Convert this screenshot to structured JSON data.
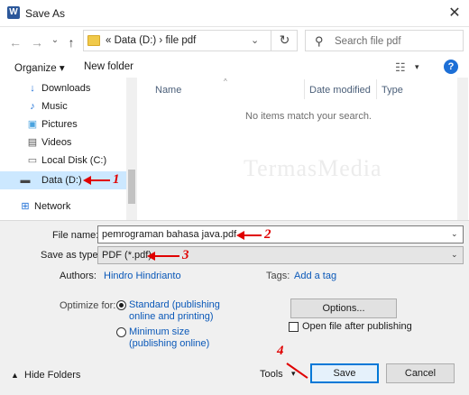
{
  "window": {
    "title": "Save As",
    "app_icon": "W",
    "close": "✕"
  },
  "nav": {
    "back": "←",
    "forward": "→",
    "down": "⌄",
    "up": "↑"
  },
  "address": {
    "path": "«  Data (D:)  ›  file pdf",
    "refresh": "↻",
    "dropdown": "⌄"
  },
  "search": {
    "placeholder": "Search file pdf",
    "icon": "search-icon"
  },
  "toolbar": {
    "organize": "Organize ▾",
    "new_folder": "New folder",
    "view": "☷",
    "view_drop": "▾",
    "help": "?"
  },
  "sidebar": {
    "items": [
      {
        "label": "Downloads",
        "icon": "↓",
        "color": "#1d6fd6"
      },
      {
        "label": "Music",
        "icon": "♪",
        "color": "#1d6fd6"
      },
      {
        "label": "Pictures",
        "icon": "▣",
        "color": "#4aa3df"
      },
      {
        "label": "Videos",
        "icon": "▤",
        "color": "#555555"
      },
      {
        "label": "Local Disk (C:)",
        "icon": "▭",
        "color": "#666666"
      },
      {
        "label": "Data (D:)",
        "icon": "▬",
        "color": "#444444"
      },
      {
        "label": "Network",
        "icon": "⊞",
        "color": "#1d6fd6"
      }
    ]
  },
  "filelist": {
    "columns": [
      "Name",
      "Date modified",
      "Type"
    ],
    "empty_message": "No items match your search.",
    "watermark": "TermasMedia"
  },
  "form": {
    "file_name_label": "File name:",
    "file_name_value": "pemrograman bahasa java.pdf",
    "save_as_type_label": "Save as type:",
    "save_as_type_value": "PDF (*.pdf)",
    "authors_label": "Authors:",
    "authors_value": "Hindro Hindrianto",
    "tags_label": "Tags:",
    "tags_value": "Add a tag",
    "optimize_label": "Optimize for:",
    "opt_standard_1": "Standard (publishing",
    "opt_standard_2": "online and printing)",
    "opt_minimum_1": "Minimum size",
    "opt_minimum_2": "(publishing online)",
    "options_button": "Options...",
    "open_after": "Open file after publishing"
  },
  "footer": {
    "hide_folders": "Hide Folders",
    "tools": "Tools",
    "tools_drop": "▾",
    "save": "Save",
    "cancel": "Cancel"
  },
  "annotations": [
    "1",
    "2",
    "3",
    "4"
  ],
  "colors": {
    "selected": "#cce8ff",
    "accent": "#0078d7",
    "annotation": "#e00000",
    "link": "#0a58b8"
  }
}
